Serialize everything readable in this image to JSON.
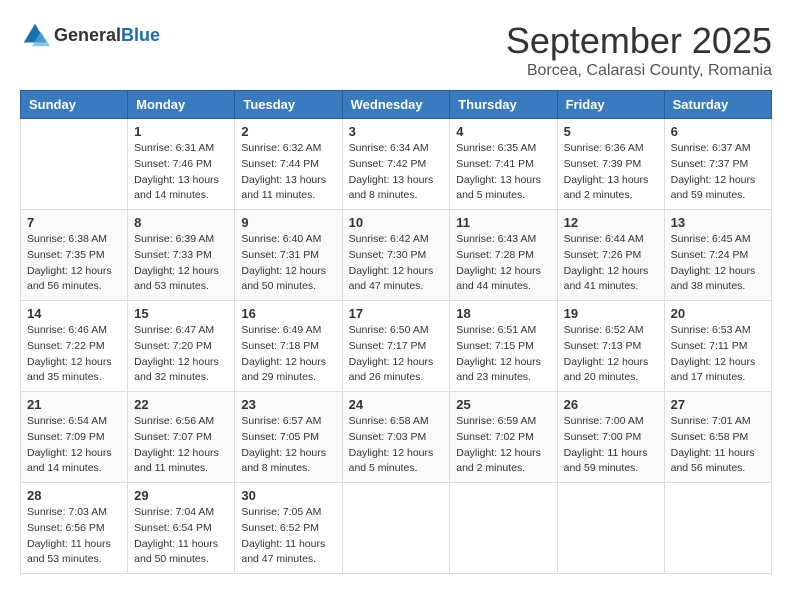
{
  "header": {
    "logo_general": "General",
    "logo_blue": "Blue",
    "month_title": "September 2025",
    "location": "Borcea, Calarasi County, Romania"
  },
  "weekdays": [
    "Sunday",
    "Monday",
    "Tuesday",
    "Wednesday",
    "Thursday",
    "Friday",
    "Saturday"
  ],
  "weeks": [
    [
      {
        "day": "",
        "sunrise": "",
        "sunset": "",
        "daylight": ""
      },
      {
        "day": "1",
        "sunrise": "Sunrise: 6:31 AM",
        "sunset": "Sunset: 7:46 PM",
        "daylight": "Daylight: 13 hours and 14 minutes."
      },
      {
        "day": "2",
        "sunrise": "Sunrise: 6:32 AM",
        "sunset": "Sunset: 7:44 PM",
        "daylight": "Daylight: 13 hours and 11 minutes."
      },
      {
        "day": "3",
        "sunrise": "Sunrise: 6:34 AM",
        "sunset": "Sunset: 7:42 PM",
        "daylight": "Daylight: 13 hours and 8 minutes."
      },
      {
        "day": "4",
        "sunrise": "Sunrise: 6:35 AM",
        "sunset": "Sunset: 7:41 PM",
        "daylight": "Daylight: 13 hours and 5 minutes."
      },
      {
        "day": "5",
        "sunrise": "Sunrise: 6:36 AM",
        "sunset": "Sunset: 7:39 PM",
        "daylight": "Daylight: 13 hours and 2 minutes."
      },
      {
        "day": "6",
        "sunrise": "Sunrise: 6:37 AM",
        "sunset": "Sunset: 7:37 PM",
        "daylight": "Daylight: 12 hours and 59 minutes."
      }
    ],
    [
      {
        "day": "7",
        "sunrise": "Sunrise: 6:38 AM",
        "sunset": "Sunset: 7:35 PM",
        "daylight": "Daylight: 12 hours and 56 minutes."
      },
      {
        "day": "8",
        "sunrise": "Sunrise: 6:39 AM",
        "sunset": "Sunset: 7:33 PM",
        "daylight": "Daylight: 12 hours and 53 minutes."
      },
      {
        "day": "9",
        "sunrise": "Sunrise: 6:40 AM",
        "sunset": "Sunset: 7:31 PM",
        "daylight": "Daylight: 12 hours and 50 minutes."
      },
      {
        "day": "10",
        "sunrise": "Sunrise: 6:42 AM",
        "sunset": "Sunset: 7:30 PM",
        "daylight": "Daylight: 12 hours and 47 minutes."
      },
      {
        "day": "11",
        "sunrise": "Sunrise: 6:43 AM",
        "sunset": "Sunset: 7:28 PM",
        "daylight": "Daylight: 12 hours and 44 minutes."
      },
      {
        "day": "12",
        "sunrise": "Sunrise: 6:44 AM",
        "sunset": "Sunset: 7:26 PM",
        "daylight": "Daylight: 12 hours and 41 minutes."
      },
      {
        "day": "13",
        "sunrise": "Sunrise: 6:45 AM",
        "sunset": "Sunset: 7:24 PM",
        "daylight": "Daylight: 12 hours and 38 minutes."
      }
    ],
    [
      {
        "day": "14",
        "sunrise": "Sunrise: 6:46 AM",
        "sunset": "Sunset: 7:22 PM",
        "daylight": "Daylight: 12 hours and 35 minutes."
      },
      {
        "day": "15",
        "sunrise": "Sunrise: 6:47 AM",
        "sunset": "Sunset: 7:20 PM",
        "daylight": "Daylight: 12 hours and 32 minutes."
      },
      {
        "day": "16",
        "sunrise": "Sunrise: 6:49 AM",
        "sunset": "Sunset: 7:18 PM",
        "daylight": "Daylight: 12 hours and 29 minutes."
      },
      {
        "day": "17",
        "sunrise": "Sunrise: 6:50 AM",
        "sunset": "Sunset: 7:17 PM",
        "daylight": "Daylight: 12 hours and 26 minutes."
      },
      {
        "day": "18",
        "sunrise": "Sunrise: 6:51 AM",
        "sunset": "Sunset: 7:15 PM",
        "daylight": "Daylight: 12 hours and 23 minutes."
      },
      {
        "day": "19",
        "sunrise": "Sunrise: 6:52 AM",
        "sunset": "Sunset: 7:13 PM",
        "daylight": "Daylight: 12 hours and 20 minutes."
      },
      {
        "day": "20",
        "sunrise": "Sunrise: 6:53 AM",
        "sunset": "Sunset: 7:11 PM",
        "daylight": "Daylight: 12 hours and 17 minutes."
      }
    ],
    [
      {
        "day": "21",
        "sunrise": "Sunrise: 6:54 AM",
        "sunset": "Sunset: 7:09 PM",
        "daylight": "Daylight: 12 hours and 14 minutes."
      },
      {
        "day": "22",
        "sunrise": "Sunrise: 6:56 AM",
        "sunset": "Sunset: 7:07 PM",
        "daylight": "Daylight: 12 hours and 11 minutes."
      },
      {
        "day": "23",
        "sunrise": "Sunrise: 6:57 AM",
        "sunset": "Sunset: 7:05 PM",
        "daylight": "Daylight: 12 hours and 8 minutes."
      },
      {
        "day": "24",
        "sunrise": "Sunrise: 6:58 AM",
        "sunset": "Sunset: 7:03 PM",
        "daylight": "Daylight: 12 hours and 5 minutes."
      },
      {
        "day": "25",
        "sunrise": "Sunrise: 6:59 AM",
        "sunset": "Sunset: 7:02 PM",
        "daylight": "Daylight: 12 hours and 2 minutes."
      },
      {
        "day": "26",
        "sunrise": "Sunrise: 7:00 AM",
        "sunset": "Sunset: 7:00 PM",
        "daylight": "Daylight: 11 hours and 59 minutes."
      },
      {
        "day": "27",
        "sunrise": "Sunrise: 7:01 AM",
        "sunset": "Sunset: 6:58 PM",
        "daylight": "Daylight: 11 hours and 56 minutes."
      }
    ],
    [
      {
        "day": "28",
        "sunrise": "Sunrise: 7:03 AM",
        "sunset": "Sunset: 6:56 PM",
        "daylight": "Daylight: 11 hours and 53 minutes."
      },
      {
        "day": "29",
        "sunrise": "Sunrise: 7:04 AM",
        "sunset": "Sunset: 6:54 PM",
        "daylight": "Daylight: 11 hours and 50 minutes."
      },
      {
        "day": "30",
        "sunrise": "Sunrise: 7:05 AM",
        "sunset": "Sunset: 6:52 PM",
        "daylight": "Daylight: 11 hours and 47 minutes."
      },
      {
        "day": "",
        "sunrise": "",
        "sunset": "",
        "daylight": ""
      },
      {
        "day": "",
        "sunrise": "",
        "sunset": "",
        "daylight": ""
      },
      {
        "day": "",
        "sunrise": "",
        "sunset": "",
        "daylight": ""
      },
      {
        "day": "",
        "sunrise": "",
        "sunset": "",
        "daylight": ""
      }
    ]
  ]
}
